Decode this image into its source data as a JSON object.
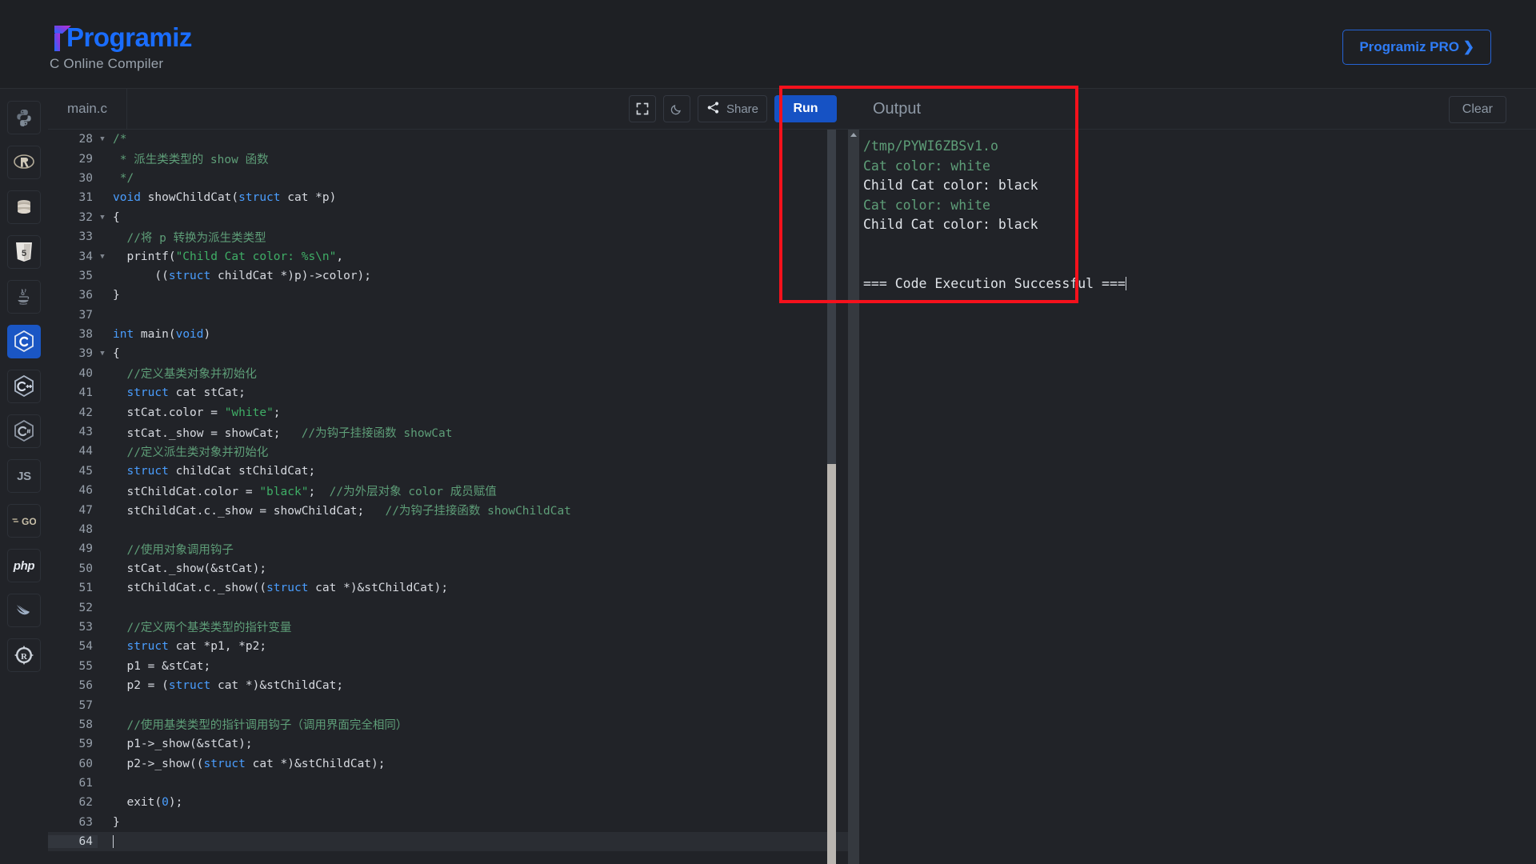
{
  "header": {
    "brand": "Programiz",
    "subtitle": "C Online Compiler",
    "pro_button": "Programiz PRO ❯",
    "brand_color": "#1a6dff",
    "pro_border_color": "#2563d4"
  },
  "sidebar": {
    "items": [
      {
        "name": "python",
        "label": "Py",
        "active": false
      },
      {
        "name": "r",
        "label": "R",
        "active": false
      },
      {
        "name": "sql",
        "label": "SQL",
        "active": false
      },
      {
        "name": "html",
        "label": "5",
        "active": false
      },
      {
        "name": "java",
        "label": "Java",
        "active": false
      },
      {
        "name": "c",
        "label": "C",
        "active": true
      },
      {
        "name": "cpp",
        "label": "C++",
        "active": false
      },
      {
        "name": "csharp",
        "label": "C#",
        "active": false
      },
      {
        "name": "javascript",
        "label": "JS",
        "active": false
      },
      {
        "name": "go",
        "label": "GO",
        "active": false
      },
      {
        "name": "php",
        "label": "php",
        "active": false
      },
      {
        "name": "swift",
        "label": "Swift",
        "active": false
      },
      {
        "name": "rust",
        "label": "R",
        "active": false
      }
    ]
  },
  "editor": {
    "file_tab": "main.c",
    "fullscreen_icon": "fullscreen-icon",
    "theme_icon": "moon-icon",
    "share_label": "Share",
    "share_icon": "share-icon",
    "run_label": "Run",
    "run_color": "#1652c4",
    "first_line_number": 28,
    "active_line": 64,
    "lines": [
      {
        "n": 28,
        "fold": true,
        "segs": [
          {
            "t": "/*",
            "c": "cm"
          }
        ]
      },
      {
        "n": 29,
        "fold": false,
        "segs": [
          {
            "t": " * 派生类类型的 show 函数",
            "c": "cm"
          }
        ]
      },
      {
        "n": 30,
        "fold": false,
        "segs": [
          {
            "t": " */",
            "c": "cm"
          }
        ]
      },
      {
        "n": 31,
        "fold": false,
        "segs": [
          {
            "t": "void",
            "c": "kw"
          },
          {
            "t": " showChildCat(",
            "c": ""
          },
          {
            "t": "struct",
            "c": "kw"
          },
          {
            "t": " cat *p)",
            "c": ""
          }
        ]
      },
      {
        "n": 32,
        "fold": true,
        "segs": [
          {
            "t": "{",
            "c": ""
          }
        ]
      },
      {
        "n": 33,
        "fold": false,
        "segs": [
          {
            "t": "  //将 p 转换为派生类类型",
            "c": "cm"
          }
        ]
      },
      {
        "n": 34,
        "fold": true,
        "segs": [
          {
            "t": "  printf(",
            "c": ""
          },
          {
            "t": "\"Child Cat color: %s\\n\"",
            "c": "str"
          },
          {
            "t": ",",
            "c": ""
          }
        ]
      },
      {
        "n": 35,
        "fold": false,
        "segs": [
          {
            "t": "      ((",
            "c": ""
          },
          {
            "t": "struct",
            "c": "kw"
          },
          {
            "t": " childCat *)p)->color);",
            "c": ""
          }
        ]
      },
      {
        "n": 36,
        "fold": false,
        "segs": [
          {
            "t": "}",
            "c": ""
          }
        ]
      },
      {
        "n": 37,
        "fold": false,
        "segs": []
      },
      {
        "n": 38,
        "fold": false,
        "segs": [
          {
            "t": "int",
            "c": "kw"
          },
          {
            "t": " main(",
            "c": ""
          },
          {
            "t": "void",
            "c": "kw"
          },
          {
            "t": ")",
            "c": ""
          }
        ]
      },
      {
        "n": 39,
        "fold": true,
        "segs": [
          {
            "t": "{",
            "c": ""
          }
        ]
      },
      {
        "n": 40,
        "fold": false,
        "segs": [
          {
            "t": "  //定义基类对象并初始化",
            "c": "cm"
          }
        ]
      },
      {
        "n": 41,
        "fold": false,
        "segs": [
          {
            "t": "  ",
            "c": ""
          },
          {
            "t": "struct",
            "c": "kw"
          },
          {
            "t": " cat stCat;",
            "c": ""
          }
        ]
      },
      {
        "n": 42,
        "fold": false,
        "segs": [
          {
            "t": "  stCat.color = ",
            "c": ""
          },
          {
            "t": "\"white\"",
            "c": "str"
          },
          {
            "t": ";",
            "c": ""
          }
        ]
      },
      {
        "n": 43,
        "fold": false,
        "segs": [
          {
            "t": "  stCat._show = showCat;   ",
            "c": ""
          },
          {
            "t": "//为钩子挂接函数 showCat",
            "c": "cm"
          }
        ]
      },
      {
        "n": 44,
        "fold": false,
        "segs": [
          {
            "t": "  //定义派生类对象并初始化",
            "c": "cm"
          }
        ]
      },
      {
        "n": 45,
        "fold": false,
        "segs": [
          {
            "t": "  ",
            "c": ""
          },
          {
            "t": "struct",
            "c": "kw"
          },
          {
            "t": " childCat stChildCat;",
            "c": ""
          }
        ]
      },
      {
        "n": 46,
        "fold": false,
        "segs": [
          {
            "t": "  stChildCat.color = ",
            "c": ""
          },
          {
            "t": "\"black\"",
            "c": "str"
          },
          {
            "t": ";  ",
            "c": ""
          },
          {
            "t": "//为外层对象 color 成员赋值",
            "c": "cm"
          }
        ]
      },
      {
        "n": 47,
        "fold": false,
        "segs": [
          {
            "t": "  stChildCat.c._show = showChildCat;   ",
            "c": ""
          },
          {
            "t": "//为钩子挂接函数 showChildCat",
            "c": "cm"
          }
        ]
      },
      {
        "n": 48,
        "fold": false,
        "segs": []
      },
      {
        "n": 49,
        "fold": false,
        "segs": [
          {
            "t": "  //使用对象调用钩子",
            "c": "cm"
          }
        ]
      },
      {
        "n": 50,
        "fold": false,
        "segs": [
          {
            "t": "  stCat._show(&stCat);",
            "c": ""
          }
        ]
      },
      {
        "n": 51,
        "fold": false,
        "segs": [
          {
            "t": "  stChildCat.c._show((",
            "c": ""
          },
          {
            "t": "struct",
            "c": "kw"
          },
          {
            "t": " cat *)&stChildCat);",
            "c": ""
          }
        ]
      },
      {
        "n": 52,
        "fold": false,
        "segs": []
      },
      {
        "n": 53,
        "fold": false,
        "segs": [
          {
            "t": "  //定义两个基类类型的指针变量",
            "c": "cm"
          }
        ]
      },
      {
        "n": 54,
        "fold": false,
        "segs": [
          {
            "t": "  ",
            "c": ""
          },
          {
            "t": "struct",
            "c": "kw"
          },
          {
            "t": " cat *p1, *p2;",
            "c": ""
          }
        ]
      },
      {
        "n": 55,
        "fold": false,
        "segs": [
          {
            "t": "  p1 = &stCat;",
            "c": ""
          }
        ]
      },
      {
        "n": 56,
        "fold": false,
        "segs": [
          {
            "t": "  p2 = (",
            "c": ""
          },
          {
            "t": "struct",
            "c": "kw"
          },
          {
            "t": " cat *)&stChildCat;",
            "c": ""
          }
        ]
      },
      {
        "n": 57,
        "fold": false,
        "segs": []
      },
      {
        "n": 58,
        "fold": false,
        "segs": [
          {
            "t": "  //使用基类类型的指针调用钩子（调用界面完全相同）",
            "c": "cm"
          }
        ]
      },
      {
        "n": 59,
        "fold": false,
        "segs": [
          {
            "t": "  p1->_show(&stCat);",
            "c": ""
          }
        ]
      },
      {
        "n": 60,
        "fold": false,
        "segs": [
          {
            "t": "  p2->_show((",
            "c": ""
          },
          {
            "t": "struct",
            "c": "kw"
          },
          {
            "t": " cat *)&stChildCat);",
            "c": ""
          }
        ]
      },
      {
        "n": 61,
        "fold": false,
        "segs": []
      },
      {
        "n": 62,
        "fold": false,
        "segs": [
          {
            "t": "  exit(",
            "c": ""
          },
          {
            "t": "0",
            "c": "num"
          },
          {
            "t": ");",
            "c": ""
          }
        ]
      },
      {
        "n": 63,
        "fold": false,
        "segs": [
          {
            "t": "}",
            "c": ""
          }
        ]
      },
      {
        "n": 64,
        "fold": false,
        "segs": []
      }
    ]
  },
  "output": {
    "title": "Output",
    "clear_label": "Clear",
    "highlight_color": "#f5111c",
    "lines": [
      {
        "text": "/tmp/PYWI6ZBSv1.o",
        "green": true
      },
      {
        "text": "Cat color: white",
        "green": true
      },
      {
        "text": "Child Cat color: black",
        "green": false
      },
      {
        "text": "Cat color: white",
        "green": true
      },
      {
        "text": "Child Cat color: black",
        "green": false
      },
      {
        "text": "",
        "green": false
      },
      {
        "text": "",
        "green": false
      },
      {
        "text": "=== Code Execution Successful ===",
        "green": false,
        "cursor": true
      }
    ]
  }
}
